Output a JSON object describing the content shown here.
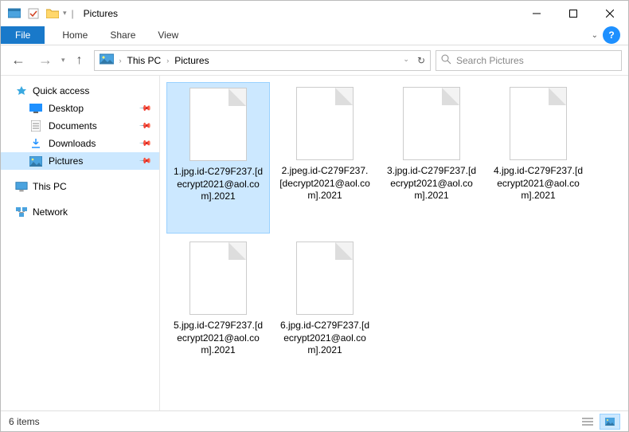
{
  "window": {
    "title": "Pictures"
  },
  "ribbon": {
    "file": "File",
    "tabs": [
      "Home",
      "Share",
      "View"
    ]
  },
  "address": {
    "crumbs": [
      "This PC",
      "Pictures"
    ]
  },
  "search": {
    "placeholder": "Search Pictures"
  },
  "sidebar": {
    "quick_access": "Quick access",
    "items": [
      {
        "label": "Desktop",
        "pinned": true
      },
      {
        "label": "Documents",
        "pinned": true
      },
      {
        "label": "Downloads",
        "pinned": true
      },
      {
        "label": "Pictures",
        "pinned": true,
        "selected": true
      }
    ],
    "this_pc": "This PC",
    "network": "Network"
  },
  "files": [
    {
      "name": "1.jpg.id-C279F237.[decrypt2021@aol.com].2021",
      "selected": true
    },
    {
      "name": "2.jpeg.id-C279F237.[decrypt2021@aol.com].2021"
    },
    {
      "name": "3.jpg.id-C279F237.[decrypt2021@aol.com].2021"
    },
    {
      "name": "4.jpg.id-C279F237.[decrypt2021@aol.com].2021"
    },
    {
      "name": "5.jpg.id-C279F237.[decrypt2021@aol.com].2021"
    },
    {
      "name": "6.jpg.id-C279F237.[decrypt2021@aol.com].2021"
    }
  ],
  "status": {
    "text": "6 items"
  }
}
